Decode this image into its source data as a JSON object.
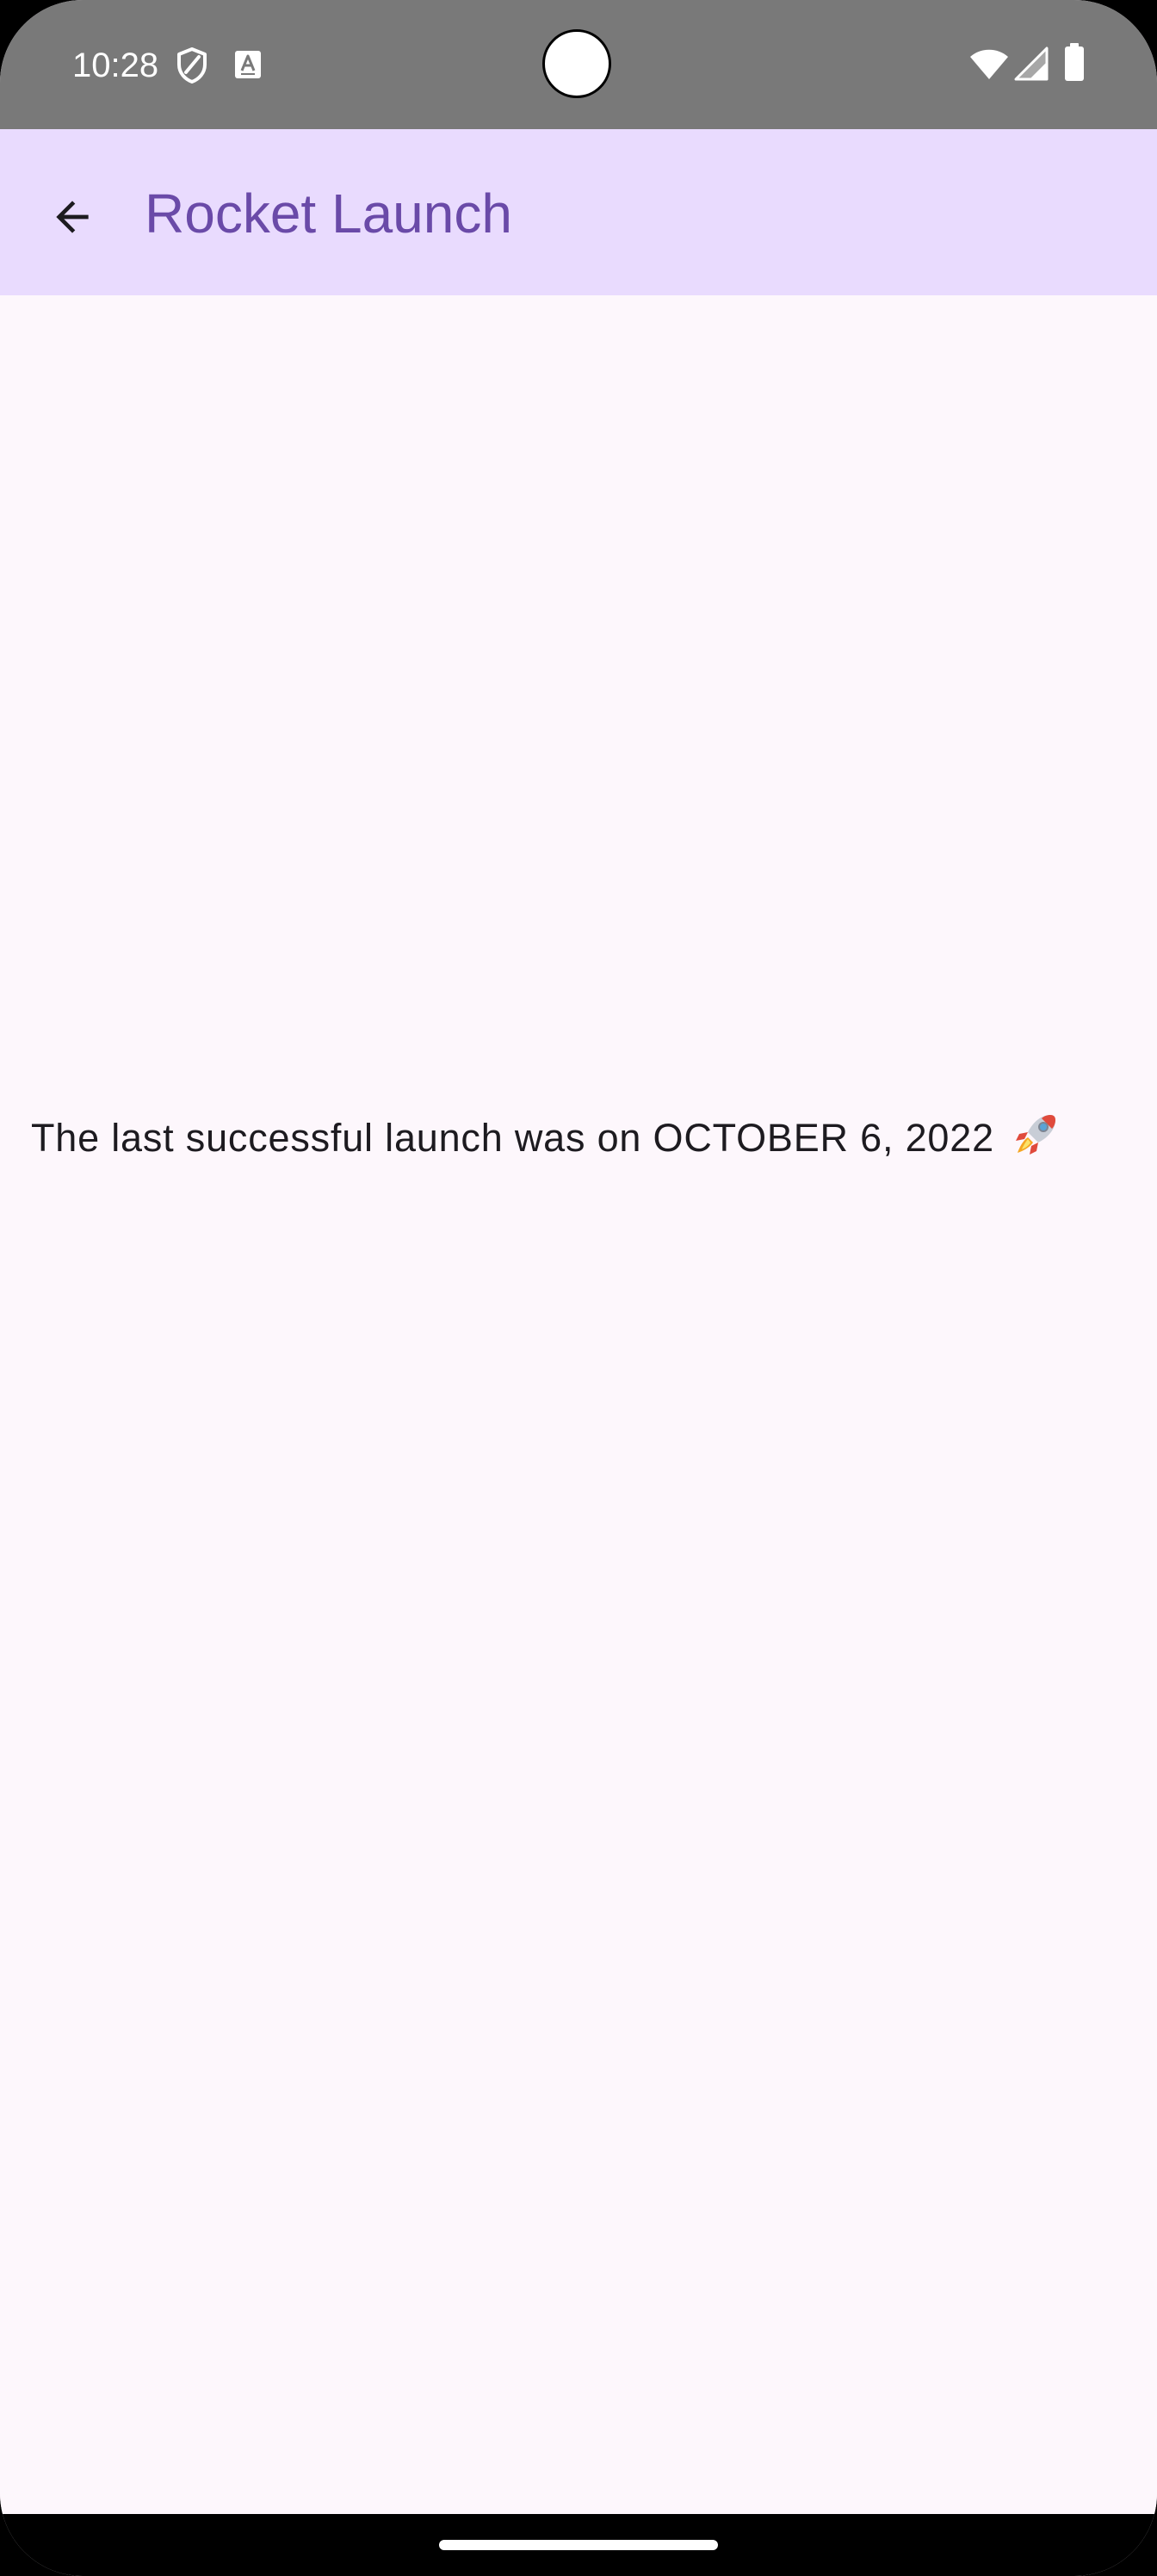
{
  "status_bar": {
    "time": "10:28",
    "icons": [
      "shield-icon",
      "keyboard-a-icon",
      "wifi-icon",
      "cell-signal-icon",
      "battery-icon"
    ]
  },
  "app_bar": {
    "title": "Rocket Launch",
    "back_icon": "arrow-back-icon"
  },
  "main": {
    "message": "The last successful launch was on OCTOBER 6, 2022",
    "message_icon": "rocket-emoji-icon"
  },
  "colors": {
    "status_bar_bg": "#797979",
    "app_bar_bg": "#e9dbfe",
    "title_color": "#6a4aa8",
    "content_bg": "#fdf7fc",
    "text_color": "#1d1b20"
  }
}
